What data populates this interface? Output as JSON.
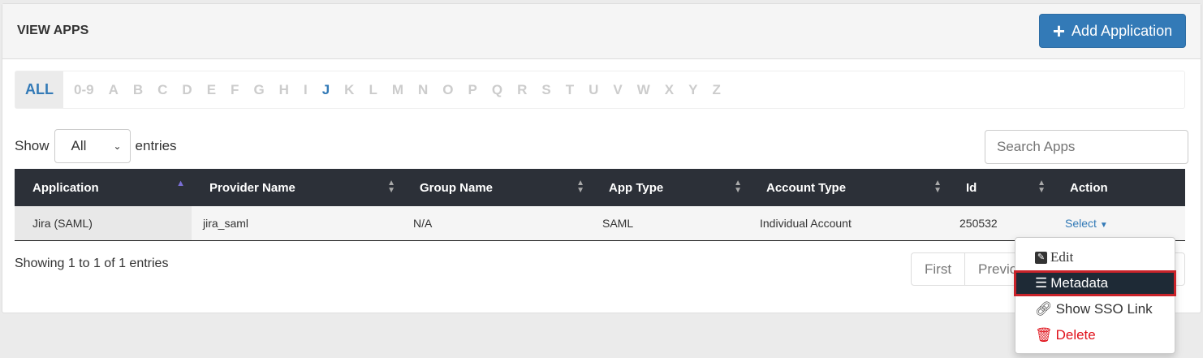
{
  "header": {
    "title": "VIEW APPS",
    "add_label": "Add Application"
  },
  "alphabet": {
    "items": [
      "ALL",
      "0-9",
      "A",
      "B",
      "C",
      "D",
      "E",
      "F",
      "G",
      "H",
      "I",
      "J",
      "K",
      "L",
      "M",
      "N",
      "O",
      "P",
      "Q",
      "R",
      "S",
      "T",
      "U",
      "V",
      "W",
      "X",
      "Y",
      "Z"
    ],
    "active": "ALL",
    "highlighted": "J"
  },
  "length": {
    "show": "Show",
    "value": "All",
    "entries": "entries"
  },
  "search": {
    "placeholder": "Search Apps"
  },
  "table": {
    "columns": [
      "Application",
      "Provider Name",
      "Group Name",
      "App Type",
      "Account Type",
      "Id",
      "Action"
    ],
    "rows": [
      {
        "application": "Jira (SAML)",
        "provider": "jira_saml",
        "group": "N/A",
        "app_type": "SAML",
        "account_type": "Individual Account",
        "id": "250532",
        "action": "Select"
      }
    ]
  },
  "footer": {
    "info": "Showing 1 to 1 of 1 entries",
    "pager": [
      "First",
      "Previous"
    ]
  },
  "menu": {
    "items": [
      "Edit",
      "Metadata",
      "Show SSO Link",
      "Delete"
    ]
  },
  "colors": {
    "primary": "#337ab7",
    "header_dark": "#2c3038",
    "danger": "#e0121b",
    "highlight_border": "#c9232a"
  }
}
